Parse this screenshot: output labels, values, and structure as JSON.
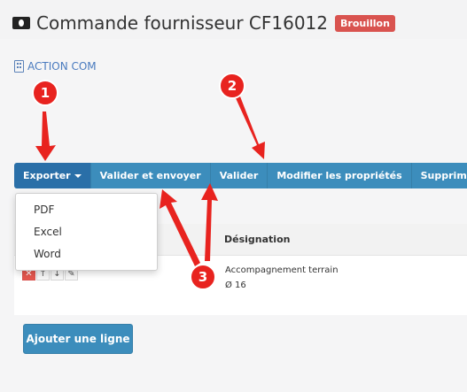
{
  "header": {
    "title": "Commande fournisseur CF16012",
    "status_badge": "Brouillon"
  },
  "supplier": {
    "name": "ACTION COM"
  },
  "toolbar": {
    "export_label": "Exporter",
    "validate_send_label": "Valider et envoyer",
    "validate_label": "Valider",
    "edit_properties_label": "Modifier les propriétés",
    "delete_label": "Supprimer"
  },
  "export_menu": {
    "items": [
      "PDF",
      "Excel",
      "Word"
    ]
  },
  "table": {
    "columns": [
      "Désignation"
    ],
    "rows": [
      {
        "description": "Accompagnement terrain",
        "quantity": "Ø 16"
      }
    ]
  },
  "actions": {
    "add_line_label": "Ajouter une ligne"
  },
  "annotations": {
    "markers": [
      "1",
      "2",
      "3"
    ],
    "color": "#e8231f"
  },
  "colors": {
    "primary_button": "#3c8dbc",
    "danger_badge": "#d9534f",
    "link": "#4a7bbf"
  }
}
